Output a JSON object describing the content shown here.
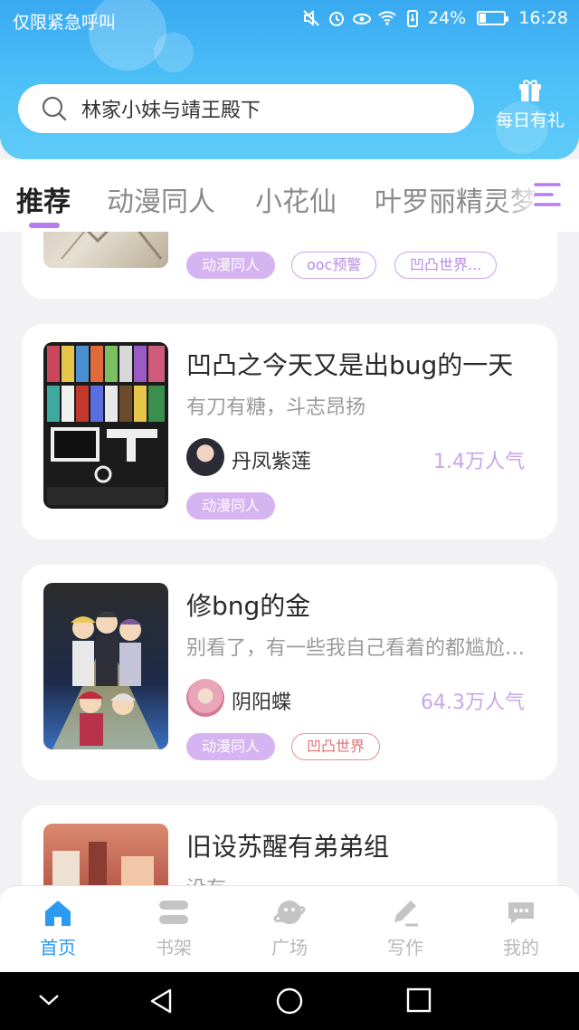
{
  "status": {
    "left_text": "仅限紧急呼叫",
    "battery": "24%",
    "time": "16:28"
  },
  "search": {
    "placeholder": "林家小妹与靖王殿下"
  },
  "gift": {
    "label": "每日有礼"
  },
  "tabs": [
    {
      "label": "推荐",
      "active": true
    },
    {
      "label": "动漫同人"
    },
    {
      "label": "小花仙"
    },
    {
      "label": "叶罗丽精灵梦"
    }
  ],
  "cards": [
    {
      "tags": [
        {
          "label": "动漫同人"
        },
        {
          "label": "ooc预警"
        },
        {
          "label": "凹凸世界..."
        }
      ]
    },
    {
      "title": "凹凸之今天又是出bug的一天",
      "desc": "有刀有糖，斗志昂扬",
      "author": "丹凤紫莲",
      "popularity": "1.4万人气",
      "tags": [
        {
          "label": "动漫同人"
        }
      ]
    },
    {
      "title": "修bng的金",
      "desc": "别看了，有一些我自己看着的都尴尬了的东西",
      "author": "阴阳蝶",
      "popularity": "64.3万人气",
      "tags": [
        {
          "label": "动漫同人"
        },
        {
          "label": "凹凸世界"
        }
      ]
    },
    {
      "title": "旧设苏醒有弟弟组",
      "desc": "没有"
    }
  ],
  "bottom_nav": [
    {
      "label": "首页",
      "icon": "home-icon",
      "active": true
    },
    {
      "label": "书架",
      "icon": "bookshelf-icon"
    },
    {
      "label": "广场",
      "icon": "planet-icon"
    },
    {
      "label": "写作",
      "icon": "pen-icon"
    },
    {
      "label": "我的",
      "icon": "chat-bubble-icon"
    }
  ],
  "colors": {
    "header": "#4ec1f7",
    "accent": "#b57cf0",
    "nav_active": "#2a9bf0",
    "tag_fill": "#d6b3f1"
  }
}
